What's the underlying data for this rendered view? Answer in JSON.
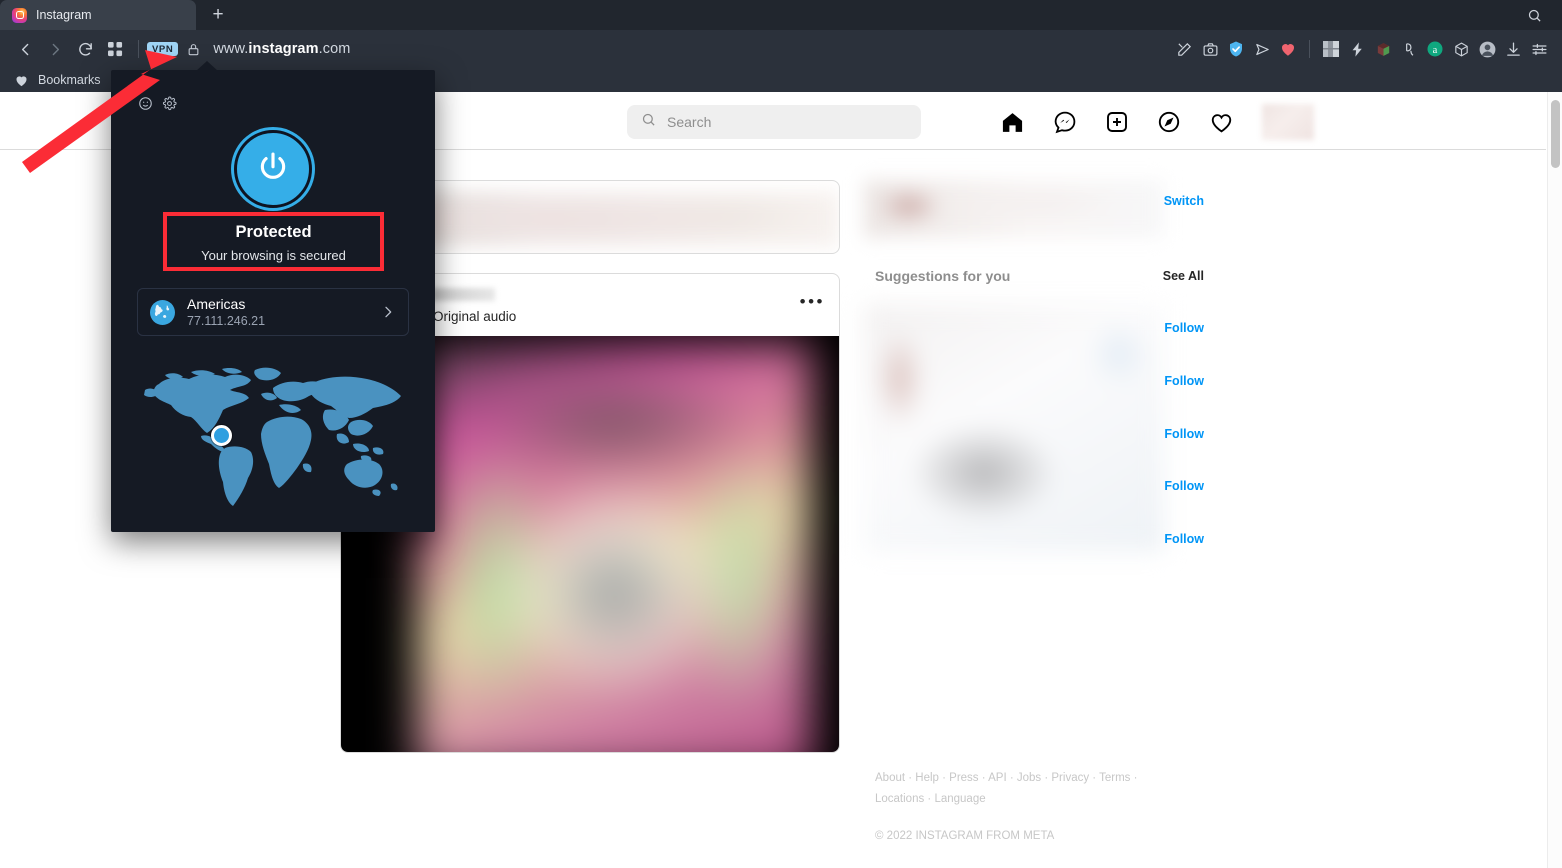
{
  "browser": {
    "tab": {
      "title": "Instagram",
      "favicon": "instagram-icon"
    },
    "new_tab_label": "+",
    "titlebar_search_icon": "search-icon",
    "toolbar": {
      "back_icon": "chevron-left-icon",
      "forward_icon": "chevron-right-icon",
      "reload_icon": "reload-icon",
      "tabs_overview_icon": "grid-icon",
      "vpn_badge": "VPN",
      "lock_icon": "lock-icon",
      "url_prefix": "www.",
      "url_domain": "instagram",
      "url_suffix": ".com",
      "extensions": [
        "edit-pin-icon",
        "camera-icon",
        "shield-check-icon",
        "send-icon",
        "heart-icon",
        "grid-blur-icon",
        "lightning-icon",
        "cube-icon",
        "crypto-icon",
        "amazon-icon",
        "box-icon",
        "profile-icon",
        "download-icon",
        "settings-sliders-icon"
      ]
    },
    "bookmarks": {
      "icon": "heart-icon",
      "label": "Bookmarks"
    }
  },
  "vpn_popup": {
    "emoji_icon": "smiley-icon",
    "settings_icon": "gear-icon",
    "power_icon": "power-icon",
    "status_title": "Protected",
    "status_subtitle": "Your browsing is secured",
    "region": {
      "globe_icon": "globe-icon",
      "name": "Americas",
      "ip": "77.111.246.21",
      "chevron_icon": "chevron-right-icon"
    },
    "map_icon": "world-map",
    "location_pin_icon": "location-dot-icon",
    "highlight_color": "#fb2c36",
    "accent_color": "#35aee8"
  },
  "instagram": {
    "nav": {
      "search_placeholder": "Search",
      "search_icon": "search-icon",
      "icons": [
        "home-icon",
        "messenger-icon",
        "new-post-icon",
        "explore-icon",
        "activity-heart-icon"
      ],
      "avatar": "avatar"
    },
    "post": {
      "meta": "mz · Original audio",
      "more_icon": "more-options-icon"
    },
    "sidebar": {
      "switch_label": "Switch",
      "suggestions_title": "Suggestions for you",
      "see_all_label": "See All",
      "follow_labels": [
        "Follow",
        "Follow",
        "Follow",
        "Follow",
        "Follow"
      ],
      "link_color": "#0095f6"
    },
    "footer": {
      "links_line1": "About · Help · Press · API · Jobs · Privacy · Terms ·",
      "links_line2": "Locations · Language",
      "copyright": "© 2022 INSTAGRAM FROM META"
    }
  }
}
